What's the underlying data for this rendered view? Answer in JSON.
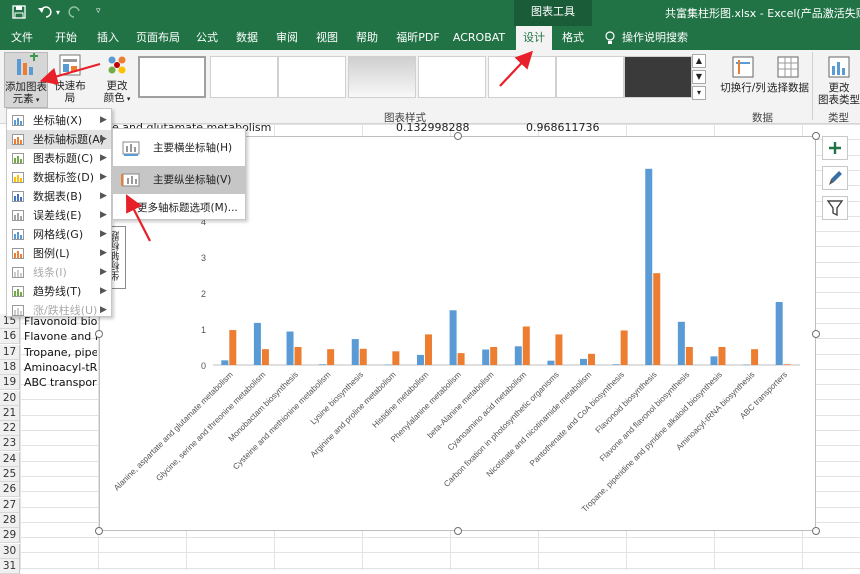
{
  "titlebar": {
    "doc_title": "共富集柱形图.xlsx  -  Excel(产品激活失败)",
    "context_group": "图表工具",
    "save_icon": "save-icon",
    "undo_icon": "undo-icon",
    "redo_icon": "redo-icon"
  },
  "tabs": [
    {
      "label": "文件"
    },
    {
      "label": "开始"
    },
    {
      "label": "插入"
    },
    {
      "label": "页面布局"
    },
    {
      "label": "公式"
    },
    {
      "label": "数据"
    },
    {
      "label": "审阅"
    },
    {
      "label": "视图"
    },
    {
      "label": "帮助"
    },
    {
      "label": "福昕PDF"
    },
    {
      "label": "ACROBAT"
    },
    {
      "label": "设计"
    },
    {
      "label": "格式"
    },
    {
      "label": "操作说明搜索"
    }
  ],
  "ribbon": {
    "add_element_l1": "添加图表",
    "add_element_l2": "元素",
    "quick_layout": "快速布局",
    "change_color_l1": "更改",
    "change_color_l2": "颜色",
    "group_styles": "图表样式",
    "switch_rowcol": "切换行/列",
    "select_data": "选择数据",
    "group_data": "数据",
    "change_type_l1": "更改",
    "change_type_l2": "图表类型",
    "group_type": "类型"
  },
  "sheet": {
    "row1_text": "e and glutamate metabolism",
    "row1_val1": "0.132998288",
    "row1_val2": "0.968611736",
    "rows": [
      {
        "num": "15",
        "text": "Flavonoid bios"
      },
      {
        "num": "16",
        "text": "Flavone and fl"
      },
      {
        "num": "17",
        "text": "Tropane, pipe"
      },
      {
        "num": "18",
        "text": "Aminoacyl-tR"
      },
      {
        "num": "19",
        "text": "ABC transport"
      },
      {
        "num": "20",
        "text": ""
      },
      {
        "num": "21",
        "text": ""
      },
      {
        "num": "22",
        "text": ""
      },
      {
        "num": "23",
        "text": ""
      },
      {
        "num": "24",
        "text": ""
      },
      {
        "num": "25",
        "text": ""
      },
      {
        "num": "26",
        "text": ""
      },
      {
        "num": "27",
        "text": ""
      },
      {
        "num": "28",
        "text": ""
      },
      {
        "num": "29",
        "text": ""
      },
      {
        "num": "30",
        "text": ""
      },
      {
        "num": "31",
        "text": ""
      }
    ]
  },
  "menu": {
    "items": [
      {
        "label": "坐标轴(X)",
        "icon": "axis-icon",
        "disabled": false,
        "highlight": false
      },
      {
        "label": "坐标轴标题(A)",
        "icon": "axis-title-icon",
        "disabled": false,
        "highlight": true
      },
      {
        "label": "图表标题(C)",
        "icon": "chart-title-icon",
        "disabled": false,
        "highlight": false
      },
      {
        "label": "数据标签(D)",
        "icon": "data-label-icon",
        "disabled": false,
        "highlight": false
      },
      {
        "label": "数据表(B)",
        "icon": "data-table-icon",
        "disabled": false,
        "highlight": false
      },
      {
        "label": "误差线(E)",
        "icon": "error-bar-icon",
        "disabled": false,
        "highlight": false
      },
      {
        "label": "网格线(G)",
        "icon": "gridline-icon",
        "disabled": false,
        "highlight": false
      },
      {
        "label": "图例(L)",
        "icon": "legend-icon",
        "disabled": false,
        "highlight": false
      },
      {
        "label": "线条(I)",
        "icon": "lines-icon",
        "disabled": true,
        "highlight": false
      },
      {
        "label": "趋势线(T)",
        "icon": "trendline-icon",
        "disabled": false,
        "highlight": false
      },
      {
        "label": "涨/跌柱线(U)",
        "icon": "updown-bar-icon",
        "disabled": true,
        "highlight": false
      }
    ]
  },
  "submenu": {
    "primary_horizontal": "主要横坐标轴(H)",
    "primary_vertical": "主要纵坐标轴(V)",
    "more_options": "更多轴标题选项(M)..."
  },
  "axis_title_placeholder": "坐标轴标题",
  "colors": {
    "excel_green": "#217346",
    "series1": "#5b9bd5",
    "series2": "#ed7d31",
    "arrow": "#e8202a"
  },
  "chart_data": {
    "type": "bar",
    "ylim": [
      0,
      5.5
    ],
    "yticks": [
      "0",
      "1",
      "2",
      "3",
      "4"
    ],
    "categories": [
      "Alanine, aspartate and glutamate metabolism",
      "Glycine, serine and threonine metabolism",
      "Monobactam biosynthesis",
      "Cysteine and methionine metabolism",
      "Lysine biosynthesis",
      "Arginine and proline metabolism",
      "Histidine metabolism",
      "Phenylalanine metabolism",
      "beta-Alanine metabolism",
      "Cyanoamino acid metabolism",
      "Carbon fixation in photosynthetic organisms",
      "Nicotinate and nicotinamide metabolism",
      "Pantothenate and CoA biosynthesis",
      "Flavonoid biosynthesis",
      "Flavone and flavonol biosynthesis",
      "Tropane, piperidine and pyridine alkaloid biosynthesis",
      "Aminoacyl-tRNA biosynthesis",
      "ABC transporters"
    ],
    "series": [
      {
        "values": [
          0.13,
          1.17,
          0.93,
          0.02,
          0.72,
          0.01,
          0.28,
          1.52,
          0.43,
          0.52,
          0.12,
          0.17,
          0.02,
          5.45,
          1.2,
          0.24,
          0.01,
          1.75
        ]
      },
      {
        "values": [
          0.97,
          0.44,
          0.5,
          0.44,
          0.45,
          0.38,
          0.85,
          0.33,
          0.5,
          1.07,
          0.85,
          0.31,
          0.96,
          2.55,
          0.5,
          0.5,
          0.44,
          0.02
        ]
      }
    ]
  }
}
